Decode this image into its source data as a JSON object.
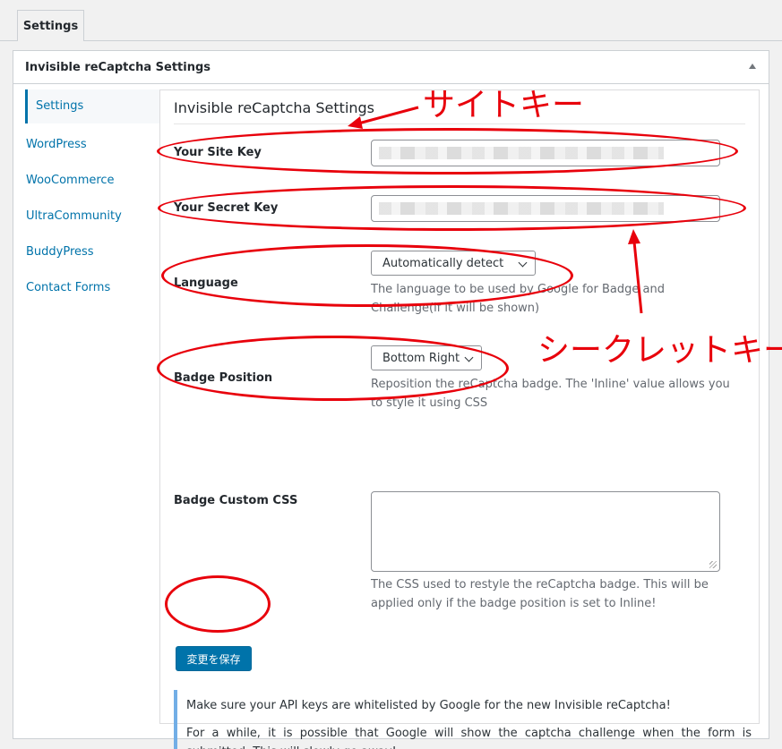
{
  "tab": {
    "label": "Settings"
  },
  "panel": {
    "title": "Invisible reCaptcha Settings"
  },
  "sidebar": {
    "items": [
      {
        "label": "Settings"
      },
      {
        "label": "WordPress"
      },
      {
        "label": "WooCommerce"
      },
      {
        "label": "UltraCommunity"
      },
      {
        "label": "BuddyPress"
      },
      {
        "label": "Contact Forms"
      }
    ]
  },
  "content": {
    "title": "Invisible reCaptcha Settings",
    "site_key_label": "Your Site Key",
    "secret_key_label": "Your Secret Key",
    "language_label": "Language",
    "language_value": "Automatically detect",
    "language_desc": "The language to be used by Google for Badge and Challenge(if it will be shown)",
    "badge_position_label": "Badge Position",
    "badge_position_value": "Bottom Right",
    "badge_position_desc": "Reposition the reCaptcha badge. The 'Inline' value allows you to style it using CSS",
    "badge_css_label": "Badge Custom CSS",
    "badge_css_value": "",
    "badge_css_desc": "The CSS used to restyle the reCaptcha badge. This will be applied only if the badge position is set to Inline!",
    "save_label": "変更を保存"
  },
  "notice": {
    "line1": "Make sure your API keys are whitelisted by Google for the new Invisible reCaptcha!",
    "line2": "For a while, it is possible that Google will show the captcha challenge when the form is submitted. This will slowly go away!"
  },
  "annotations": {
    "site_key": "サイトキー",
    "secret_key": "シークレットキー",
    "color": "#e8000b"
  }
}
